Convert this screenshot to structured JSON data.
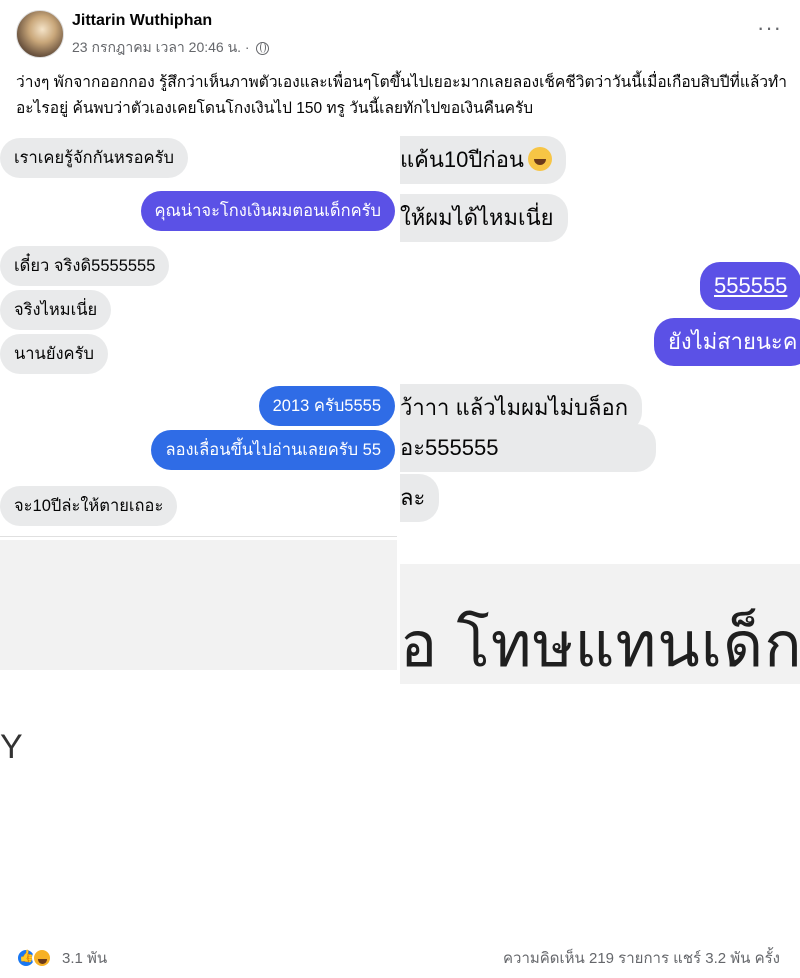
{
  "post": {
    "author": "Jittarin Wuthiphan",
    "timestamp": "23 กรกฎาคม เวลา 20:46 น. ·",
    "privacy_icon": "globe-icon",
    "more_label": "···",
    "text": "ว่างๆ พักจากออกกอง รู้สึกว่าเห็นภาพตัวเองและเพื่อนๆโตขึ้นไปเยอะมากเลยลองเช็คชีวิตว่าวันนี้เมื่อเกือบสิบปีที่แล้วทำอะไรอยู่ ค้นพบว่าตัวเองเคยโดนโกงเงินไป 150 ทรู วันนี้เลยทักไปขอเงินคืนครับ"
  },
  "left_chat": {
    "messages": [
      {
        "side": "received",
        "text": "เราเคยรู้จักกันหรอครับ"
      },
      {
        "side": "sent",
        "text": "คุณน่าจะโกงเงินผมตอนเด็กครับ"
      },
      {
        "side": "received",
        "text": "เดี๋ยว จริงดิ5555555"
      },
      {
        "side": "received",
        "text": "จริงไหมเนี่ย"
      },
      {
        "side": "received",
        "text": "นานยังครับ"
      },
      {
        "side": "sent",
        "text": "2013 ครับ5555"
      },
      {
        "side": "sent",
        "text": "ลองเลื่อนขึ้นไปอ่านเลยครับ 55"
      },
      {
        "side": "received",
        "text": "จะ10ปีล่ะให้ตายเถอะ"
      }
    ],
    "bottom_text": "Y"
  },
  "right_chat": {
    "messages": [
      {
        "side": "received",
        "text": "แค้น10ปีก่อน"
      },
      {
        "side": "received",
        "text": "ให้ผมได้ไหมเนี่ย"
      },
      {
        "side": "sent",
        "text": "555555"
      },
      {
        "side": "sent",
        "text": "ยังไม่สายนะค"
      },
      {
        "side": "received",
        "text": "ว้าาา แล้วไมผมไม่บล็อก"
      },
      {
        "side": "received",
        "text": "อะ555555"
      },
      {
        "side": "received",
        "text": "ละ"
      }
    ],
    "big_text": "อ โทษแทนเด็ก"
  },
  "footer": {
    "reaction_icons": [
      "like-icon",
      "haha-icon"
    ],
    "reaction_count": "3.1 พัน",
    "stats": "ความคิดเห็น 219 รายการ  แชร์ 3.2 พัน ครั้ง"
  },
  "colors": {
    "sent_bubble_purple": "#5b51e6",
    "sent_bubble_blue": "#2f6ce6",
    "received_bubble": "#e9eaeb",
    "meta_text": "#65676b"
  }
}
